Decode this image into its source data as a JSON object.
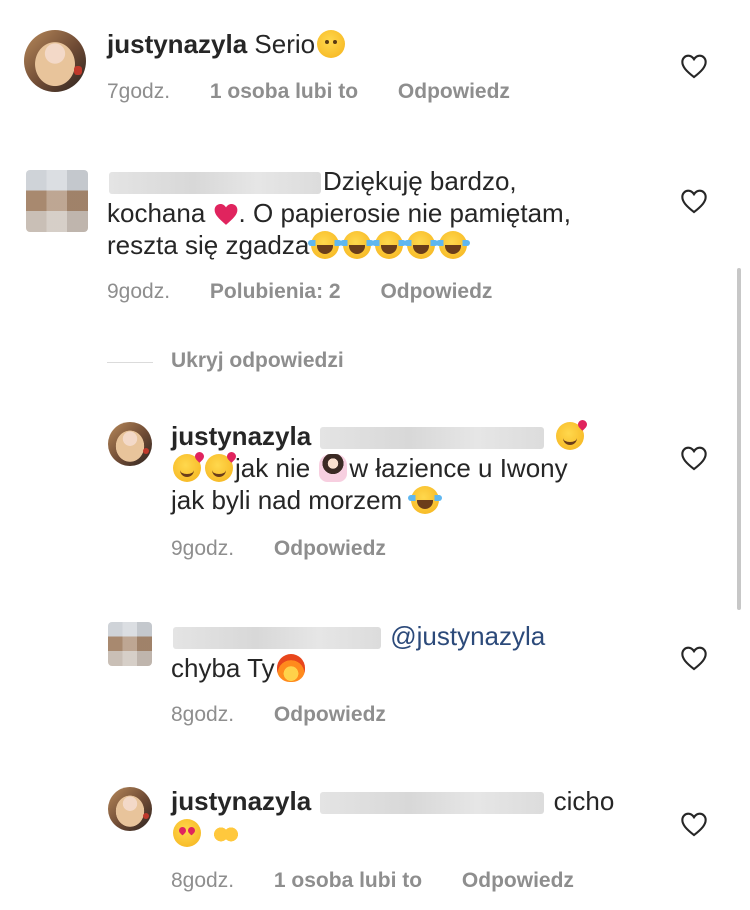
{
  "colors": {
    "meta": "#8e8e8e",
    "text": "#262626",
    "mention": "#2c4a7a",
    "heart_emoji": "#e0245e"
  },
  "comments": [
    {
      "username": "justynazyla",
      "text": "Serio",
      "emoji": [
        "thinking-face"
      ],
      "time": "7godz.",
      "likes": "1 osoba lubi to",
      "reply": "Odpowiedz"
    },
    {
      "line1": "Dziękuję bardzo,",
      "line2a": "kochana",
      "line2b": ". O papierosie nie pamiętam,",
      "line3": "reszta się zgadza",
      "emoji": [
        "red-heart",
        "tears-of-joy",
        "tears-of-joy",
        "tears-of-joy",
        "tears-of-joy",
        "tears-of-joy"
      ],
      "time": "9godz.",
      "likes": "Polubienia: 2",
      "reply": "Odpowiedz"
    }
  ],
  "hide_replies": "Ukryj odpowiedzi",
  "replies": [
    {
      "username": "justynazyla",
      "line2": "jak nie",
      "line2b": "w łazience u Iwony",
      "line3": "jak byli nad morzem",
      "emoji": [
        "smiling-face-with-hearts",
        "smiling-face-with-hearts",
        "smiling-face-with-hearts",
        "woman-facepalming",
        "tears-of-joy"
      ],
      "time": "9godz.",
      "reply": "Odpowiedz"
    },
    {
      "mention": "@justynazyla",
      "line2": "chyba Ty",
      "emoji": [
        "fire"
      ],
      "time": "8godz.",
      "reply": "Odpowiedz"
    },
    {
      "username": "justynazyla",
      "text": "cicho",
      "emoji": [
        "heart-eyes",
        "raising-hands"
      ],
      "time": "8godz.",
      "likes": "1 osoba lubi to",
      "reply": "Odpowiedz"
    }
  ]
}
